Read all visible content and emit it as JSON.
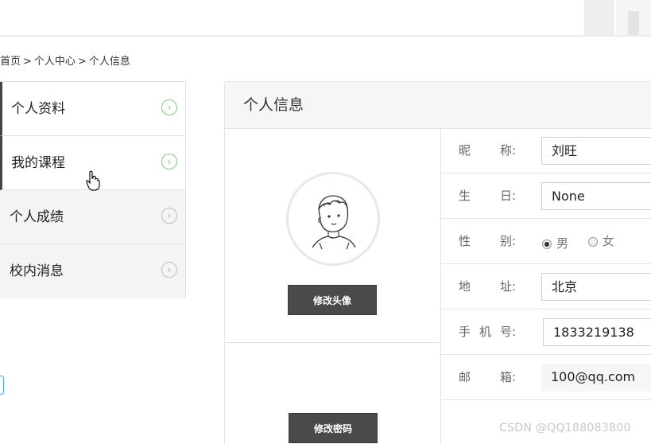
{
  "breadcrumb": {
    "home": "首页",
    "center": "个人中心",
    "current": "个人信息",
    "separator": ">"
  },
  "sidebar": {
    "items": [
      {
        "label": "个人资料",
        "state": "active"
      },
      {
        "label": "我的课程",
        "state": "active"
      },
      {
        "label": "个人成绩",
        "state": "inactive"
      },
      {
        "label": "校内消息",
        "state": "inactive"
      }
    ]
  },
  "panel": {
    "title": "个人信息",
    "change_avatar_label": "修改头像",
    "change_password_label": "修改密码"
  },
  "form": {
    "nickname": {
      "label_a": "昵",
      "label_b": "称:",
      "value": "刘旺"
    },
    "birthday": {
      "label_a": "生",
      "label_b": "日:",
      "value": "None"
    },
    "gender": {
      "label_a": "性",
      "label_b": "别:",
      "options": [
        {
          "label": "男",
          "checked": true
        },
        {
          "label": "女",
          "checked": false
        }
      ]
    },
    "address": {
      "label_a": "地",
      "label_b": "址:",
      "value": "北京"
    },
    "phone": {
      "label_a": "手",
      "label_b": "机",
      "label_c": "号:",
      "value": "1833219138"
    },
    "email": {
      "label_a": "邮",
      "label_b": "箱:",
      "value": "100@qq.com"
    }
  },
  "watermark": "CSDN @QQ188083800",
  "colors": {
    "accent_green": "#7dcb7d",
    "button_dark": "#4a4a4a",
    "edge_blue": "#46a6e8"
  }
}
